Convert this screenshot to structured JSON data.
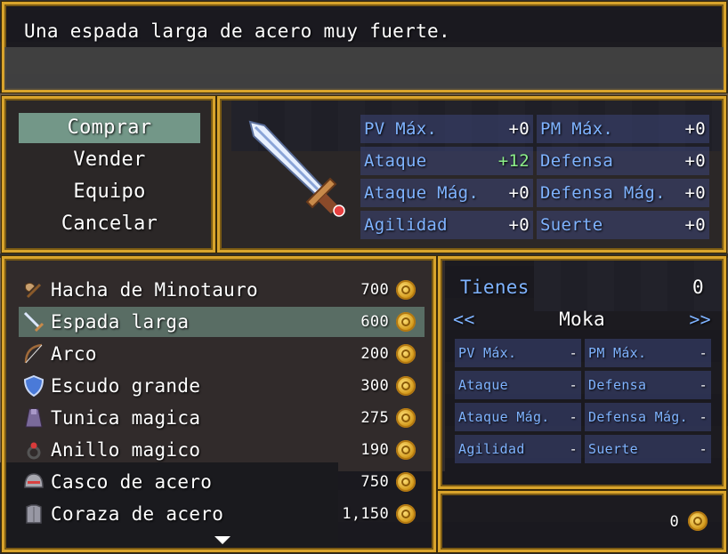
{
  "help": {
    "text": "Una espada larga de acero muy fuerte."
  },
  "commands": [
    {
      "label": "Comprar",
      "selected": true
    },
    {
      "label": "Vender"
    },
    {
      "label": "Equipo"
    },
    {
      "label": "Cancelar"
    }
  ],
  "item_stats": {
    "icon": "sword-icon",
    "rows": [
      {
        "label": "PV Máx.",
        "value": "+0"
      },
      {
        "label": "PM Máx.",
        "value": "+0"
      },
      {
        "label": "Ataque",
        "value": "+12"
      },
      {
        "label": "Defensa",
        "value": "+0"
      },
      {
        "label": "Ataque Mág.",
        "value": "+0"
      },
      {
        "label": "Defensa Mág.",
        "value": "+0"
      },
      {
        "label": "Agilidad",
        "value": "+0"
      },
      {
        "label": "Suerte",
        "value": "+0"
      }
    ]
  },
  "shop_items": [
    {
      "name": "Hacha de Minotauro",
      "price": "700",
      "icon": "axe-icon"
    },
    {
      "name": "Espada larga",
      "price": "600",
      "icon": "sword-icon",
      "selected": true
    },
    {
      "name": "Arco",
      "price": "200",
      "icon": "bow-icon"
    },
    {
      "name": "Escudo grande",
      "price": "300",
      "icon": "shield-icon"
    },
    {
      "name": "Tunica magica",
      "price": "275",
      "icon": "robe-icon"
    },
    {
      "name": "Anillo magico",
      "price": "190",
      "icon": "ring-icon"
    },
    {
      "name": "Casco de acero",
      "price": "750",
      "icon": "helmet-icon"
    },
    {
      "name": "Coraza de acero",
      "price": "1,150",
      "icon": "armor-icon"
    }
  ],
  "possession": {
    "label": "Tienes",
    "count": "0",
    "prev": "<<",
    "next": ">>",
    "actor": "Moka",
    "rows": [
      {
        "label": "PV Máx.",
        "value": "-"
      },
      {
        "label": "PM Máx.",
        "value": "-"
      },
      {
        "label": "Ataque",
        "value": "-"
      },
      {
        "label": "Defensa",
        "value": "-"
      },
      {
        "label": "Ataque Mág.",
        "value": "-"
      },
      {
        "label": "Defensa Mág.",
        "value": "-"
      },
      {
        "label": "Agilidad",
        "value": "-"
      },
      {
        "label": "Suerte",
        "value": "-"
      }
    ]
  },
  "gold": {
    "value": "0"
  },
  "colors": {
    "frame": "#d9a42c",
    "system_blue": "#7fb3ff",
    "increase": "#8cf088"
  }
}
